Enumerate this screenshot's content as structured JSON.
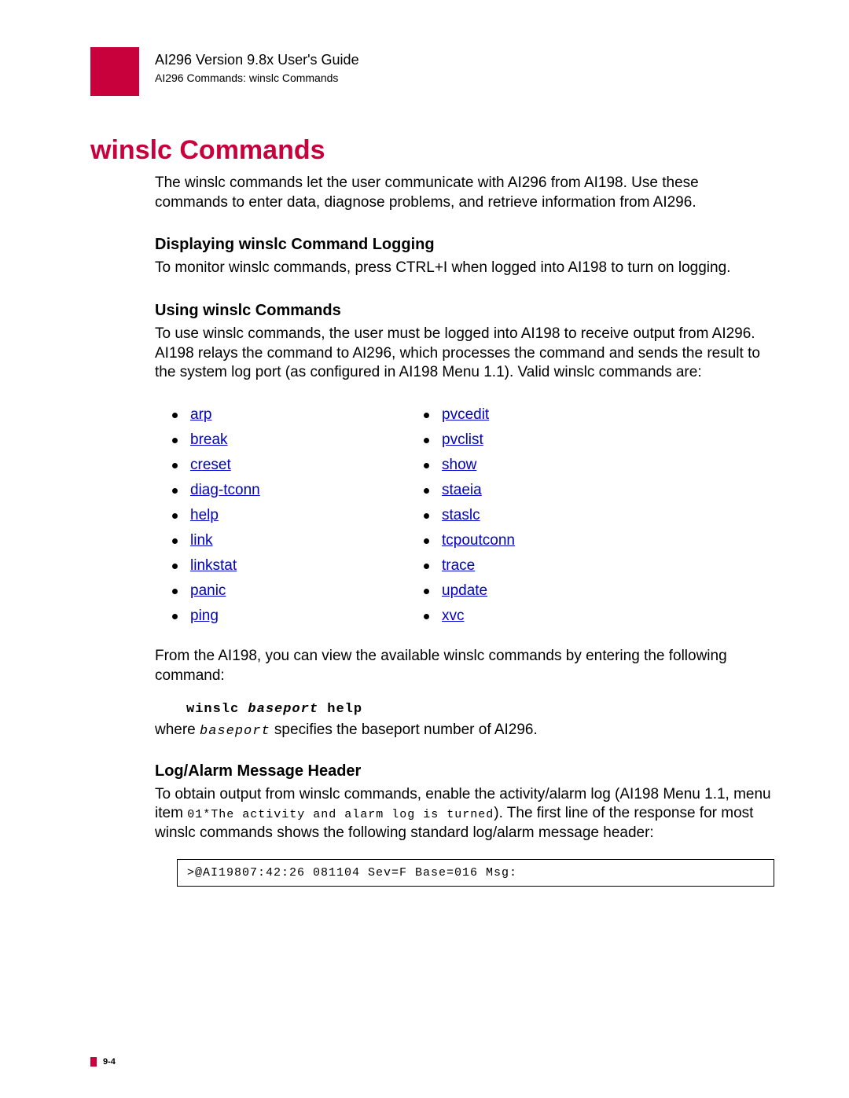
{
  "header": {
    "guide_title": "AI296 Version 9.8x User's Guide",
    "breadcrumb": "AI296 Commands: winslc Commands"
  },
  "title": "winslc Commands",
  "intro": "The winslc commands let the user communicate with AI296 from AI198. Use these commands to enter data, diagnose problems, and retrieve information from AI296.",
  "section1": {
    "heading": "Displaying winslc Command Logging",
    "body": "To monitor winslc commands, press CTRL+I when logged into AI198 to turn on logging."
  },
  "section2": {
    "heading": "Using winslc Commands",
    "body": "To use winslc commands, the user must be logged into AI198 to receive output from AI296. AI198 relays the command to AI296, which processes the command and sends the result to the system log port (as configured in AI198 Menu 1.1). Valid winslc commands are:",
    "commands_left": [
      "arp",
      "break",
      "creset",
      "diag-tconn",
      "help",
      "link",
      "linkstat",
      "panic",
      "ping"
    ],
    "commands_right": [
      "pvcedit",
      "pvclist",
      "show",
      "staeia",
      "staslc",
      "tcpoutconn",
      "trace",
      "update",
      "xvc"
    ],
    "after_list": "From the AI198, you can view the available winslc commands by entering the following command:",
    "code_prefix": "winslc ",
    "code_param": "baseport",
    "code_suffix": " help",
    "where_prefix": "where ",
    "where_param": "baseport",
    "where_suffix": " specifies the baseport number of AI296."
  },
  "section3": {
    "heading": "Log/Alarm Message Header",
    "body_1": "To obtain output from winslc commands, enable the activity/alarm log (AI198 Menu 1.1, menu item ",
    "body_code": "01*The activity and alarm log is turned",
    "body_2": "). The first line of the response for most winslc commands shows the following standard log/alarm message header:",
    "log_example": ">@AI19807:42:26 081104 Sev=F Base=016 Msg:"
  },
  "footer": {
    "page": "9-4"
  }
}
